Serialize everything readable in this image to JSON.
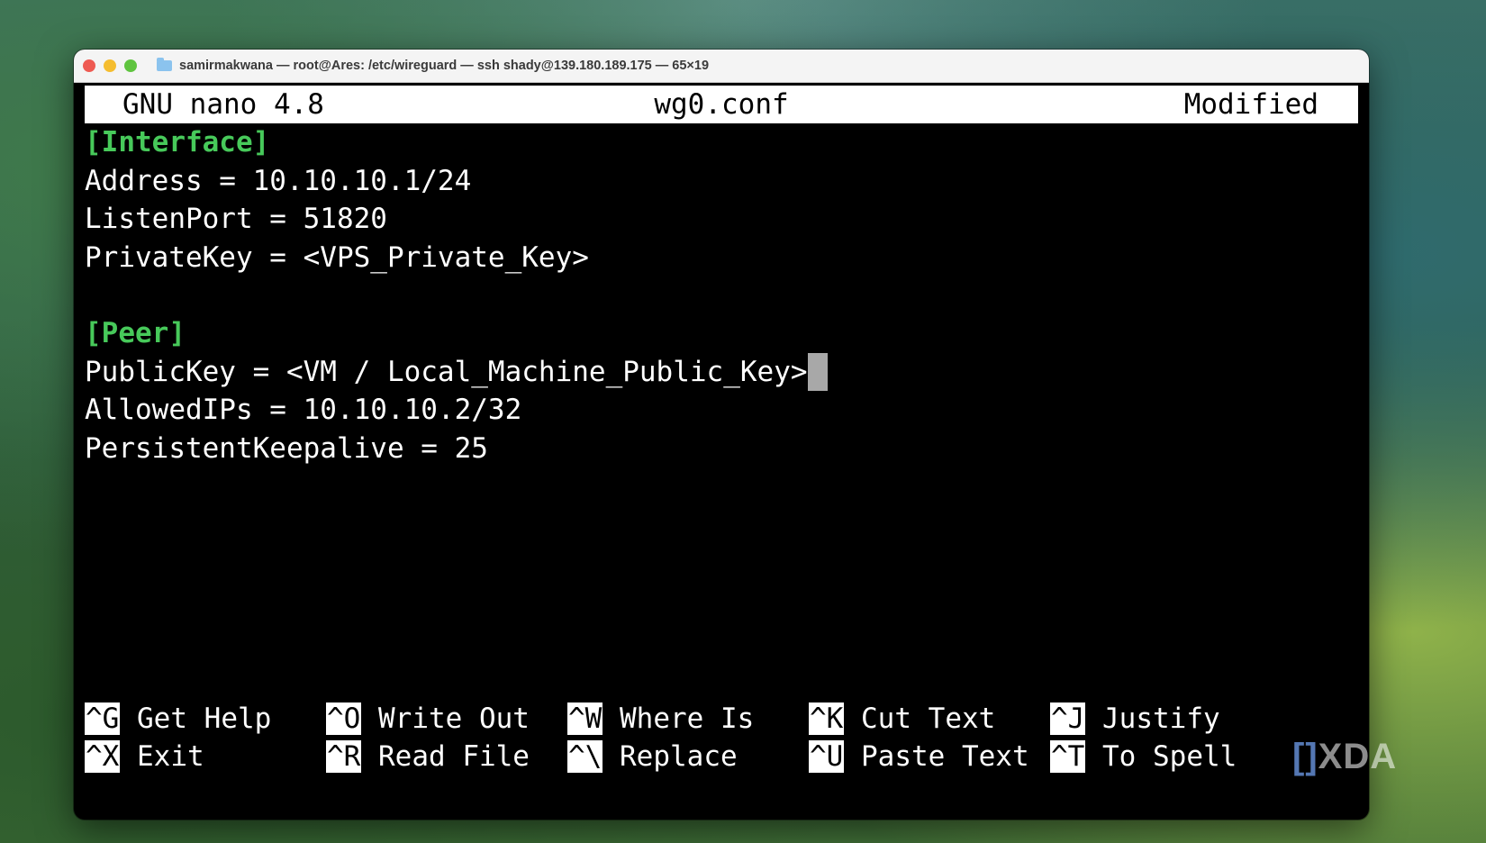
{
  "window": {
    "title": "samirmakwana — root@Ares: /etc/wireguard — ssh shady@139.180.189.175 — 65×19",
    "traffic_lights": {
      "close": "#ee5a52",
      "minimize": "#f5bd2f",
      "zoom": "#5fc43f"
    }
  },
  "nano": {
    "app": "GNU nano 4.8",
    "filename": "wg0.conf",
    "status": "Modified"
  },
  "editor": {
    "lines": [
      "[Interface]",
      "Address = 10.10.10.1/24",
      "ListenPort = 51820",
      "PrivateKey = <VPS_Private_Key>",
      "",
      "[Peer]",
      "PublicKey = <VM / Local_Machine_Public_Key>",
      "AllowedIPs = 10.10.10.2/32",
      "PersistentKeepalive = 25"
    ],
    "section_color": "#47c95a"
  },
  "shortcuts": {
    "row1": [
      {
        "key": "^G",
        "label": "Get Help"
      },
      {
        "key": "^O",
        "label": "Write Out"
      },
      {
        "key": "^W",
        "label": "Where Is"
      },
      {
        "key": "^K",
        "label": "Cut Text"
      },
      {
        "key": "^J",
        "label": "Justify"
      }
    ],
    "row2": [
      {
        "key": "^X",
        "label": "Exit"
      },
      {
        "key": "^R",
        "label": "Read File"
      },
      {
        "key": "^\\",
        "label": "Replace"
      },
      {
        "key": "^U",
        "label": "Paste Text"
      },
      {
        "key": "^T",
        "label": "To Spell"
      }
    ]
  },
  "watermark": {
    "bracket": "[]",
    "text": "XDA"
  }
}
